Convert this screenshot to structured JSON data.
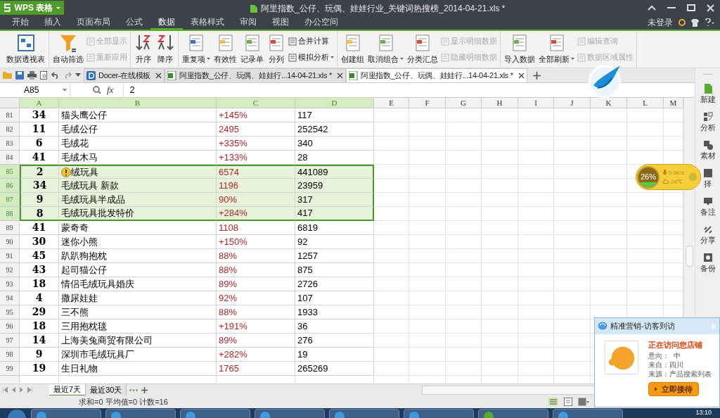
{
  "app_button": {
    "label": "WPS 表格"
  },
  "window": {
    "title": "阿里指数_公仔、玩偶、娃娃行业_关键词热搜榜_2014-04-21.xls *"
  },
  "account": {
    "label": "未登录"
  },
  "menu": [
    {
      "label": "开始",
      "selected": false
    },
    {
      "label": "插入",
      "selected": false
    },
    {
      "label": "页面布局",
      "selected": false
    },
    {
      "label": "公式",
      "selected": false
    },
    {
      "label": "数据",
      "selected": true
    },
    {
      "label": "表格样式",
      "selected": false
    },
    {
      "label": "审阅",
      "selected": false
    },
    {
      "label": "视图",
      "selected": false
    },
    {
      "label": "办公空间",
      "selected": false
    }
  ],
  "ribbon": [
    {
      "large": [
        {
          "label": "数据透视表",
          "dropdown": false,
          "disabled": false
        }
      ]
    },
    {
      "large": [
        {
          "label": "自动筛选",
          "dropdown": false,
          "disabled": false
        }
      ],
      "small": [
        {
          "label": "全部显示",
          "dropdown": false,
          "disabled": true
        },
        {
          "label": "重新应用",
          "dropdown": false,
          "disabled": true
        }
      ]
    },
    {
      "large": [
        {
          "label": "升序",
          "dropdown": false,
          "disabled": false
        },
        {
          "label": "降序",
          "dropdown": false,
          "disabled": false
        }
      ]
    },
    {
      "large": [
        {
          "label": "重复项",
          "dropdown": true,
          "disabled": false
        },
        {
          "label": "有效性",
          "dropdown": false,
          "disabled": false
        },
        {
          "label": "记录单",
          "dropdown": false,
          "disabled": false
        },
        {
          "label": "分列",
          "dropdown": false,
          "disabled": false
        }
      ],
      "small": [
        {
          "label": "合并计算",
          "dropdown": false,
          "disabled": false
        },
        {
          "label": "模拟分析",
          "dropdown": true,
          "disabled": false
        }
      ]
    },
    {
      "large": [
        {
          "label": "创建组",
          "dropdown": false,
          "disabled": false
        },
        {
          "label": "取消组合",
          "dropdown": true,
          "disabled": false
        },
        {
          "label": "分类汇总",
          "dropdown": false,
          "disabled": false
        }
      ],
      "small": [
        {
          "label": "显示明细数据",
          "dropdown": false,
          "disabled": true
        },
        {
          "label": "隐藏明细数据",
          "dropdown": false,
          "disabled": true
        }
      ]
    },
    {
      "large": [
        {
          "label": "导入数据",
          "dropdown": false,
          "disabled": false
        },
        {
          "label": "全部刷新",
          "dropdown": true,
          "disabled": false
        }
      ],
      "small": [
        {
          "label": "编辑查询",
          "dropdown": false,
          "disabled": true
        },
        {
          "label": "数据区域属性",
          "dropdown": false,
          "disabled": true
        }
      ]
    }
  ],
  "doc_tabs": [
    {
      "label": "Docer-在线模板",
      "kind": "docer",
      "selected": false
    },
    {
      "label": "阿里指数_公仔、玩偶、娃娃行...14-04-21.xls *",
      "kind": "sheet",
      "selected": false
    },
    {
      "label": "阿里指数_公仔、玩偶、娃娃行...14-04-21.xls *",
      "kind": "sheet",
      "selected": true
    }
  ],
  "formula_bar": {
    "cell": "A85",
    "fx_label": "fx",
    "formula": "2"
  },
  "columns": [
    {
      "label": "A",
      "selected": true
    },
    {
      "label": "B",
      "selected": true
    },
    {
      "label": "C",
      "selected": true
    },
    {
      "label": "D",
      "selected": true
    },
    {
      "label": "E",
      "selected": false
    },
    {
      "label": "F",
      "selected": false
    },
    {
      "label": "G",
      "selected": false
    },
    {
      "label": "H",
      "selected": false
    },
    {
      "label": "I",
      "selected": false
    },
    {
      "label": "J",
      "selected": false
    },
    {
      "label": "K",
      "selected": false
    },
    {
      "label": "L",
      "selected": false
    },
    {
      "label": "M",
      "selected": false
    }
  ],
  "rows": [
    {
      "num": "81",
      "cells": [
        "34",
        "猫头鹰公仔",
        "+145%",
        "117"
      ],
      "selected": false,
      "warning": false
    },
    {
      "num": "82",
      "cells": [
        "11",
        "毛绒公仔",
        "2495",
        "252542"
      ],
      "selected": false,
      "warning": false
    },
    {
      "num": "83",
      "cells": [
        "6",
        "毛绒花",
        "+335%",
        "340"
      ],
      "selected": false,
      "warning": false
    },
    {
      "num": "84",
      "cells": [
        "41",
        "毛绒木马",
        "+133%",
        "28"
      ],
      "selected": false,
      "warning": false
    },
    {
      "num": "85",
      "cells": [
        "2",
        "绒玩具",
        "6574",
        "441089"
      ],
      "selected": true,
      "warning": true
    },
    {
      "num": "86",
      "cells": [
        "34",
        "毛绒玩具 新款",
        "1196",
        "23959"
      ],
      "selected": true,
      "warning": false
    },
    {
      "num": "87",
      "cells": [
        "9",
        "毛绒玩具半成品",
        "90%",
        "317"
      ],
      "selected": true,
      "warning": false
    },
    {
      "num": "88",
      "cells": [
        "8",
        "毛绒玩具批发特价",
        "+284%",
        "417"
      ],
      "selected": true,
      "warning": false
    },
    {
      "num": "89",
      "cells": [
        "41",
        "蒙奇奇",
        "1108",
        "6819"
      ],
      "selected": false,
      "warning": false
    },
    {
      "num": "90",
      "cells": [
        "30",
        "迷你小熊",
        "+150%",
        "92"
      ],
      "selected": false,
      "warning": false
    },
    {
      "num": "91",
      "cells": [
        "45",
        "趴趴狗抱枕",
        "88%",
        "1257"
      ],
      "selected": false,
      "warning": false
    },
    {
      "num": "92",
      "cells": [
        "43",
        "起司猫公仔",
        "88%",
        "875"
      ],
      "selected": false,
      "warning": false
    },
    {
      "num": "93",
      "cells": [
        "18",
        "情侣毛绒玩具婚庆",
        "89%",
        "2726"
      ],
      "selected": false,
      "warning": false
    },
    {
      "num": "94",
      "cells": [
        "4",
        "撒尿娃娃",
        "92%",
        "107"
      ],
      "selected": false,
      "warning": false
    },
    {
      "num": "95",
      "cells": [
        "29",
        "三不熊",
        "88%",
        "1933"
      ],
      "selected": false,
      "warning": false
    },
    {
      "num": "96",
      "cells": [
        "18",
        "三用抱枕毯",
        "+191%",
        "36"
      ],
      "selected": false,
      "warning": false
    },
    {
      "num": "97",
      "cells": [
        "14",
        "上海美兔商贸有限公司",
        "89%",
        "276"
      ],
      "selected": false,
      "warning": false
    },
    {
      "num": "98",
      "cells": [
        "9",
        "深圳市毛绒玩具厂",
        "+282%",
        "19"
      ],
      "selected": false,
      "warning": false
    },
    {
      "num": "99",
      "cells": [
        "19",
        "生日礼物",
        "1765",
        "265269"
      ],
      "selected": false,
      "warning": false
    }
  ],
  "side_panel": [
    "新建",
    "分析",
    "素材",
    "择",
    "备注",
    "分享",
    "备份"
  ],
  "speed_widget": {
    "percent": "26%",
    "speed": "0.0K/s",
    "temperature": "26℃"
  },
  "sheet_tabs": [
    {
      "label": "最近7天",
      "selected": true
    },
    {
      "label": "最近30天",
      "selected": false
    }
  ],
  "status_bar": {
    "summary": "求和=0 平均值=0 计数=16"
  },
  "popup": {
    "title": "精准营销-访客到访",
    "headline": "正在访问您店铺",
    "lines": [
      "意向：  中",
      "来自：四川",
      "来源：产品搜索列表"
    ],
    "button": "立即接待"
  },
  "taskbar": {
    "clock": "13:10"
  }
}
